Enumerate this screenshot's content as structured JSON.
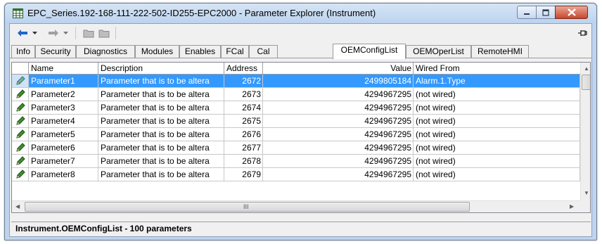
{
  "window": {
    "title": "EPC_Series.192-168-111-222-502-ID255-EPC2000 - Parameter Explorer (Instrument)",
    "accent": "#3399ff"
  },
  "toolbar": {
    "icons": [
      "back-arrow-icon",
      "dropdown-icon",
      "forward-arrow-icon",
      "dropdown-icon",
      "folder-icon",
      "folder-icon",
      "pin-icon"
    ]
  },
  "tabs": [
    {
      "label": "Info"
    },
    {
      "label": "Security"
    },
    {
      "label": "Diagnostics"
    },
    {
      "label": "Modules"
    },
    {
      "label": "Enables"
    },
    {
      "label": "FCal"
    },
    {
      "label": "Cal"
    },
    {
      "label": "OEMConfigList"
    },
    {
      "label": "OEMOperList"
    },
    {
      "label": "RemoteHMI"
    }
  ],
  "active_tab": "OEMConfigList",
  "table": {
    "columns": [
      "Name",
      "Description",
      "Address",
      "Value",
      "Wired From"
    ],
    "rows": [
      {
        "name": "Parameter1",
        "description": "Parameter that is to be altera",
        "address": "2672",
        "value": "2499805184",
        "wired_from": "Alarm.1.Type"
      },
      {
        "name": "Parameter2",
        "description": "Parameter that is to be altera",
        "address": "2673",
        "value": "4294967295",
        "wired_from": "(not wired)"
      },
      {
        "name": "Parameter3",
        "description": "Parameter that is to be altera",
        "address": "2674",
        "value": "4294967295",
        "wired_from": "(not wired)"
      },
      {
        "name": "Parameter4",
        "description": "Parameter that is to be altera",
        "address": "2675",
        "value": "4294967295",
        "wired_from": "(not wired)"
      },
      {
        "name": "Parameter5",
        "description": "Parameter that is to be altera",
        "address": "2676",
        "value": "4294967295",
        "wired_from": "(not wired)"
      },
      {
        "name": "Parameter6",
        "description": "Parameter that is to be altera",
        "address": "2677",
        "value": "4294967295",
        "wired_from": "(not wired)"
      },
      {
        "name": "Parameter7",
        "description": "Parameter that is to be altera",
        "address": "2678",
        "value": "4294967295",
        "wired_from": "(not wired)"
      },
      {
        "name": "Parameter8",
        "description": "Parameter that is to be altera",
        "address": "2679",
        "value": "4294967295",
        "wired_from": "(not wired)"
      }
    ],
    "selected_row": 0,
    "hscroll_grip": "III"
  },
  "status": {
    "text": "Instrument.OEMConfigList  -  100 parameters"
  }
}
